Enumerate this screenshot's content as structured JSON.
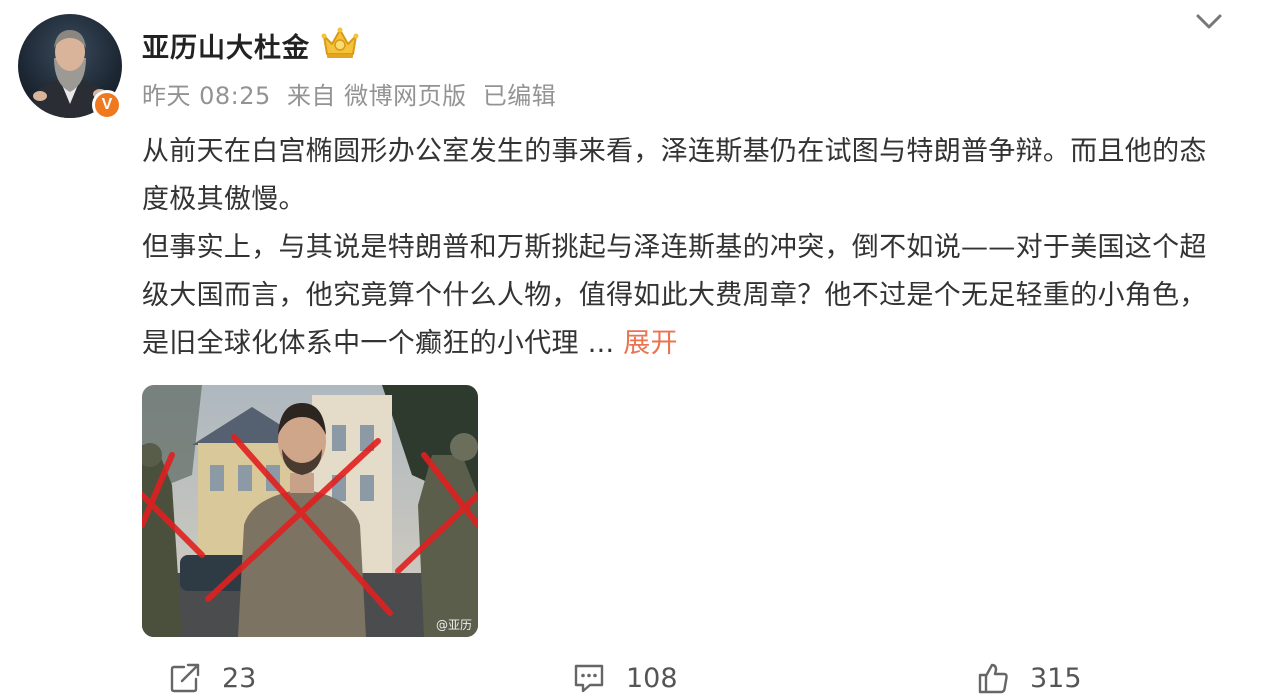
{
  "post": {
    "username": "亚历山大杜金",
    "meta": {
      "time": "昨天 08:25",
      "source": "来自 微博网页版",
      "edited": "已编辑"
    },
    "text": {
      "para1": "从前天在白宫椭圆形办公室发生的事来看，泽连斯基仍在试图与特朗普争辩。而且他的态度极其傲慢。",
      "para2": "但事实上，与其说是特朗普和万斯挑起与泽连斯基的冲突，倒不如说——对于美国这个超级大国而言，他究竟算个什么人物，值得如此大费周章？他不过是个无足轻重的小角色，是旧全球化体系中一个癫狂的小代理",
      "ellipsis": " ...",
      "expand": "展开"
    },
    "image": {
      "watermark": "@亚历"
    },
    "actions": {
      "repost_count": "23",
      "comment_count": "108",
      "like_count": "315"
    },
    "colors": {
      "accent": "#eb7350",
      "badge": "#f0791f",
      "meta": "#939393"
    },
    "icons": {
      "verified": "verified-v-badge-icon",
      "crown": "crown-icon",
      "more": "chevron-down-icon",
      "repost": "share-icon",
      "comment": "comment-icon",
      "like": "thumbs-up-icon"
    }
  }
}
